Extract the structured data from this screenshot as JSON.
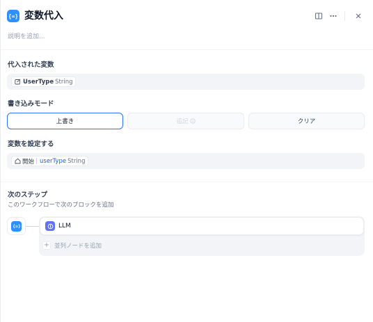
{
  "header": {
    "title": "変数代入",
    "description_placeholder": "説明を追加...",
    "icons": [
      "variable-assigner-icon",
      "book-icon",
      "more-icon",
      "close-icon"
    ]
  },
  "assigned_variable": {
    "label": "代入された変数",
    "var_name": "UserType",
    "var_type": "String",
    "icon": "variable-edit-icon"
  },
  "write_mode": {
    "label": "書き込みモード",
    "options": [
      "上書き",
      "追記",
      "クリア"
    ],
    "selected": "上書き",
    "disabled": [
      "追記"
    ]
  },
  "set_variable": {
    "label": "変数を設定する",
    "source": "開始",
    "var_name": "userType",
    "var_type": "String",
    "icon": "home-icon"
  },
  "next_step": {
    "label": "次のステップ",
    "description": "このワークフローで次のブロックを追加",
    "next_node": "LLM",
    "add_parallel": "並列ノードを追加"
  },
  "colors": {
    "accent": "#2970ff",
    "node_icon": "#2e90fa",
    "llm_icon": "#6172f3"
  }
}
